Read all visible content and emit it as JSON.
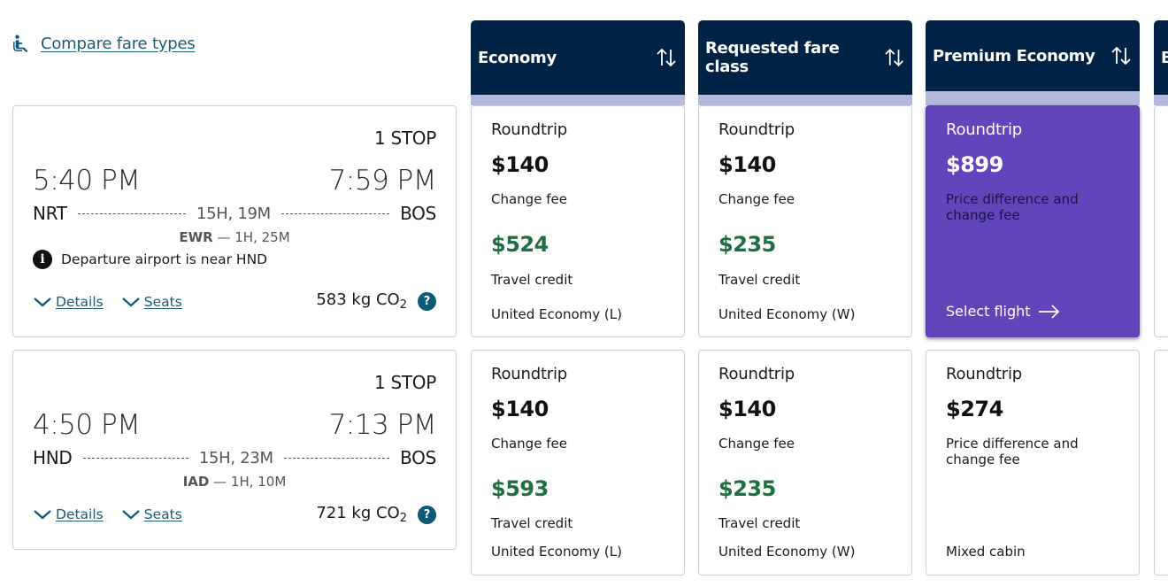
{
  "compare_link": {
    "label": "Compare fare types",
    "icon": "seat-recline-icon"
  },
  "columns": [
    {
      "title": "Economy",
      "sort_icon": "sort-arrows-icon"
    },
    {
      "title": "Requested fare class",
      "sort_icon": "sort-arrows-icon"
    },
    {
      "title": "Premium Economy",
      "sort_icon": "sort-arrows-icon"
    },
    {
      "title": "B"
    }
  ],
  "colors": {
    "header_bg": "#002244",
    "header_stripe": "#b4b8da",
    "selected_bg": "#6244bb",
    "credit_green": "#1e7043",
    "link_teal": "#1e5b74"
  },
  "flights": [
    {
      "stops": "1 STOP",
      "depart_time": "5:40 PM",
      "arrive_time": "7:59 PM",
      "origin": "NRT",
      "destination": "BOS",
      "duration": "15H, 19M",
      "layover_airport": "EWR",
      "layover_duration": "— 1H, 25M",
      "notice": "Departure airport is near HND",
      "details_label": "Details",
      "seats_label": "Seats",
      "co2_value": "583 kg CO",
      "co2_sub": "2",
      "fares": [
        {
          "trip": "Roundtrip",
          "price": "$140",
          "fee_label": "Change fee",
          "credit": "$524",
          "credit_label": "Travel credit",
          "cabin": "United Economy (L)"
        },
        {
          "trip": "Roundtrip",
          "price": "$140",
          "fee_label": "Change fee",
          "credit": "$235",
          "credit_label": "Travel credit",
          "cabin": "United Economy (W)"
        },
        {
          "trip": "Roundtrip",
          "price": "$899",
          "fee_label": "Price difference and change fee",
          "action": "Select flight",
          "selected": true
        }
      ]
    },
    {
      "stops": "1 STOP",
      "depart_time": "4:50 PM",
      "arrive_time": "7:13 PM",
      "origin": "HND",
      "destination": "BOS",
      "duration": "15H, 23M",
      "layover_airport": "IAD",
      "layover_duration": "— 1H, 10M",
      "details_label": "Details",
      "seats_label": "Seats",
      "co2_value": "721 kg CO",
      "co2_sub": "2",
      "fares": [
        {
          "trip": "Roundtrip",
          "price": "$140",
          "fee_label": "Change fee",
          "credit": "$593",
          "credit_label": "Travel credit",
          "cabin": "United Economy (L)"
        },
        {
          "trip": "Roundtrip",
          "price": "$140",
          "fee_label": "Change fee",
          "credit": "$235",
          "credit_label": "Travel credit",
          "cabin": "United Economy (W)"
        },
        {
          "trip": "Roundtrip",
          "price": "$274",
          "fee_label": "Price difference and change fee",
          "cabin": "Mixed cabin"
        }
      ]
    }
  ]
}
